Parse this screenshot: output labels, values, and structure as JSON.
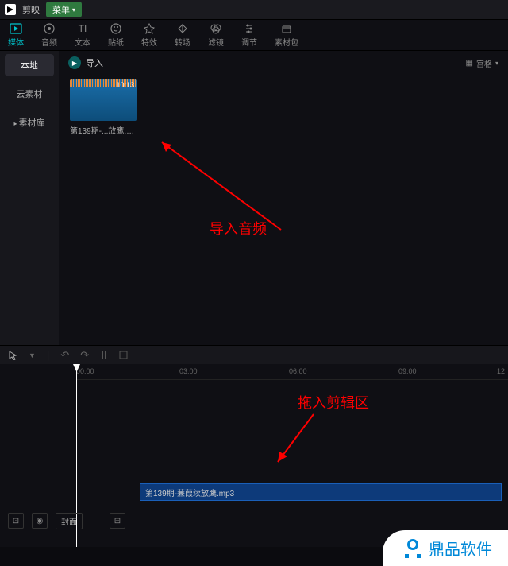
{
  "titlebar": {
    "app_name": "剪映",
    "menu_label": "菜单"
  },
  "tabs": [
    {
      "label": "媒体",
      "icon": "media"
    },
    {
      "label": "音频",
      "icon": "audio"
    },
    {
      "label": "文本",
      "icon": "text"
    },
    {
      "label": "贴纸",
      "icon": "sticker"
    },
    {
      "label": "特效",
      "icon": "fx"
    },
    {
      "label": "转场",
      "icon": "transition"
    },
    {
      "label": "滤镜",
      "icon": "filter"
    },
    {
      "label": "调节",
      "icon": "adjust"
    },
    {
      "label": "素材包",
      "icon": "pack"
    }
  ],
  "sidebar": {
    "items": [
      {
        "label": "本地",
        "active": true
      },
      {
        "label": "云素材",
        "active": false
      },
      {
        "label": "素材库",
        "active": false,
        "has_arrow": true
      }
    ]
  },
  "content": {
    "import_label": "导入",
    "view_label": "宫格",
    "media": {
      "duration": "10:13",
      "filename": "第139期-...放鹰.mp3"
    }
  },
  "annotations": {
    "a1": "导入音频",
    "a2": "拖入剪辑区"
  },
  "timeline": {
    "ticks": [
      "00:00",
      "03:00",
      "06:00",
      "09:00",
      "12"
    ],
    "clip_label": "第139期-蒹葭续放鹰.mp3",
    "cover_label": "封面"
  },
  "watermark": {
    "text": "鼎品软件"
  }
}
